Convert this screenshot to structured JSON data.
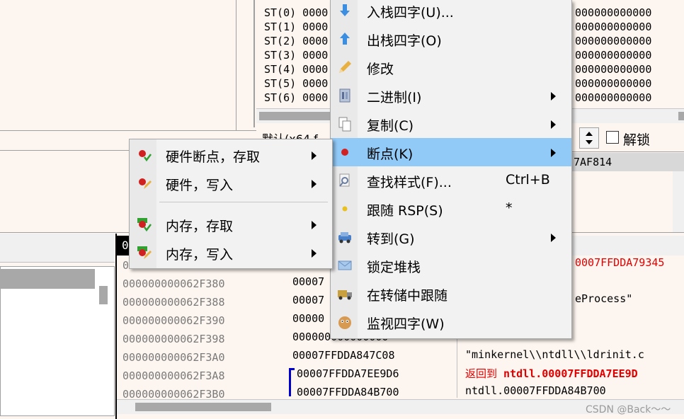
{
  "fpu": {
    "registers": [
      "ST(0) 0000",
      "ST(1) 0000",
      "ST(2) 0000",
      "ST(3) 0000",
      "ST(4) 0000",
      "ST(5) 0000",
      "ST(6) 0000"
    ],
    "values_right": [
      "000000000000",
      "000000000000",
      "000000000000",
      "000000000000",
      "000000000000",
      "000000000000",
      "000000000000"
    ],
    "default_label": "默认(x64 f",
    "lock_label": "解锁",
    "highlight_value": "7AF814"
  },
  "stack_panel": {
    "header": "0",
    "addresses": [
      "0",
      "000000000062F380",
      "000000000062F388",
      "000000000062F390",
      "000000000062F398",
      "000000000062F3A0",
      "000000000062F3A8",
      "000000000062F3B0"
    ],
    "values": [
      "00007",
      "00007",
      "00000",
      "000000000000000",
      "00007FFDDA847C08",
      "00007FFDDA7EE9D6",
      "00007FFDDA84B700"
    ],
    "comments": {
      "top_red": "0007FFDDA79345",
      "process": "eProcess\"",
      "minkernel": "\"minkernel\\\\ntdll\\\\ldrinit.c",
      "return_prefix": "返回到",
      "return_target": "ntdll.00007FFDDA7EE9D",
      "last": "ntdll.00007FFDDA84B700"
    }
  },
  "main_menu": {
    "items": [
      {
        "label": "入栈四字(U)...",
        "shortcut": "",
        "submenu": false,
        "icon": "arrow-down-icon"
      },
      {
        "label": "出栈四字(O)",
        "shortcut": "",
        "submenu": false,
        "icon": "arrow-up-icon"
      },
      {
        "label": "修改",
        "shortcut": "",
        "submenu": false,
        "icon": "pencil-icon"
      },
      {
        "label": "二进制(I)",
        "shortcut": "",
        "submenu": true,
        "icon": "binary-icon"
      },
      {
        "label": "复制(C)",
        "shortcut": "",
        "submenu": true,
        "icon": "copy-icon"
      },
      {
        "label": "断点(K)",
        "shortcut": "",
        "submenu": true,
        "icon": "breakpoint-icon"
      },
      {
        "label": "查找样式(F)...",
        "shortcut": "Ctrl+B",
        "submenu": false,
        "icon": "find-pattern-icon"
      },
      {
        "label": "跟随 RSP(S)",
        "shortcut": "*",
        "submenu": false,
        "icon": "follow-rsp-icon"
      },
      {
        "label": "转到(G)",
        "shortcut": "",
        "submenu": true,
        "icon": "goto-icon"
      },
      {
        "label": "锁定堆栈",
        "shortcut": "",
        "submenu": false,
        "icon": "lock-stack-icon"
      },
      {
        "label": "在转储中跟随",
        "shortcut": "",
        "submenu": false,
        "icon": "follow-dump-icon"
      },
      {
        "label": "监视四字(W)",
        "shortcut": "",
        "submenu": false,
        "icon": "watch-icon"
      }
    ]
  },
  "sub_menu": {
    "items": [
      {
        "label": "硬件断点，存取"
      },
      {
        "label": "硬件，写入"
      },
      {
        "label": "内存，存取"
      },
      {
        "label": "内存，写入"
      }
    ]
  },
  "watermark": "CSDN @Back～～",
  "colors": {
    "highlight": "#91c9f7",
    "red": "#e00000",
    "menu_bg": "#f2f2f2"
  }
}
